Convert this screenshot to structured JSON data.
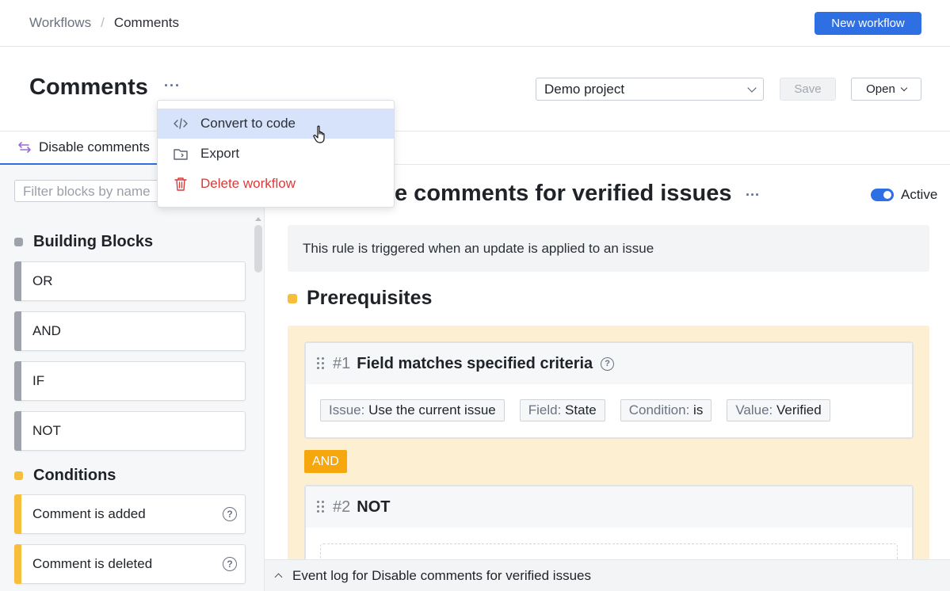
{
  "breadcrumb": {
    "parent": "Workflows",
    "separator": "/",
    "current": "Comments"
  },
  "topbar": {
    "new_workflow_label": "New workflow"
  },
  "header": {
    "title": "Comments",
    "more_label": "···",
    "project_select": "Demo project",
    "save_label": "Save",
    "open_label": "Open"
  },
  "tab": {
    "label": "Disable comments"
  },
  "menu": {
    "items": [
      {
        "label": "Convert to code",
        "icon": "code-icon"
      },
      {
        "label": "Export",
        "icon": "export-icon"
      },
      {
        "label": "Delete workflow",
        "icon": "trash-icon"
      }
    ]
  },
  "sidebar": {
    "filter_placeholder": "Filter blocks by name",
    "building_blocks": {
      "title": "Building Blocks",
      "items": [
        "OR",
        "AND",
        "IF",
        "NOT"
      ]
    },
    "conditions": {
      "title": "Conditions",
      "items": [
        "Comment is added",
        "Comment is deleted"
      ]
    }
  },
  "main": {
    "rule_title": "e comments for verified issues",
    "rule_more": "···",
    "active_label": "Active",
    "trigger_text": "This rule is triggered when an update is applied to an issue",
    "prereq_title": "Prerequisites",
    "card1": {
      "num": "#1",
      "name": "Field matches specified criteria",
      "chips": [
        {
          "k": "Issue:",
          "v": "Use the current issue"
        },
        {
          "k": "Field:",
          "v": "State"
        },
        {
          "k": "Condition:",
          "v": "is"
        },
        {
          "k": "Value:",
          "v": "Verified"
        }
      ]
    },
    "and_label": "AND",
    "card2": {
      "num": "#2",
      "name": "NOT"
    }
  },
  "eventlog": {
    "label": "Event log for Disable comments for verified issues"
  },
  "colors": {
    "accent": "#2f6fe4",
    "building_blocks": "#9ea3ab",
    "conditions": "#f6be3b",
    "danger": "#d93b3b",
    "and_badge": "#f5a70d"
  }
}
